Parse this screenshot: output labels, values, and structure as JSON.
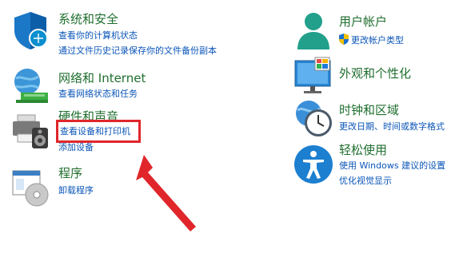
{
  "left": [
    {
      "icon": "shield-security-icon",
      "title": "系统和安全",
      "links": [
        "查看你的计算机状态",
        "通过文件历史记录保存你的文件备份副本"
      ]
    },
    {
      "icon": "network-globe-icon",
      "title": "网络和 Internet",
      "links": [
        "查看网络状态和任务"
      ]
    },
    {
      "icon": "printer-speaker-icon",
      "title": "硬件和声音",
      "links": [
        "查看设备和打印机",
        "添加设备"
      ]
    },
    {
      "icon": "programs-disc-icon",
      "title": "程序",
      "links": [
        "卸载程序"
      ]
    }
  ],
  "right": [
    {
      "icon": "user-account-icon",
      "title": "用户帐户",
      "links": [
        "更改帐户类型"
      ]
    },
    {
      "icon": "monitor-appearance-icon",
      "title": "外观和个性化",
      "links": []
    },
    {
      "icon": "clock-globe-icon",
      "title": "时钟和区域",
      "links": [
        "更改日期、时间或数字格式"
      ]
    },
    {
      "icon": "accessibility-icon",
      "title": "轻松使用",
      "links": [
        "使用 Windows 建议的设置",
        "优化视觉显示"
      ]
    }
  ],
  "colors": {
    "title": "#1f6e2e",
    "link": "#0a55b8",
    "annotation": "#e0262b"
  }
}
